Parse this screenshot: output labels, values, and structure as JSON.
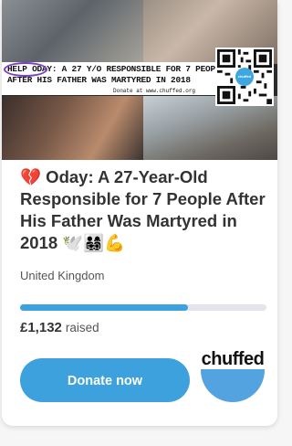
{
  "image": {
    "banner_line1": "HELP ODAY: A 27 Y/O RESPONSIBLE FOR 7 PEOPLE",
    "banner_line2": "AFTER HIS FATHER WAS MARTYRED IN 2018",
    "donate_at": "Donate at www.chuffed.org",
    "qr_logo_text": "chuffed"
  },
  "campaign": {
    "title": "💔 Oday: A 27-Year-Old Responsible for 7 People After His Father Was Martyred in 2018 🕊️👨‍👩‍👧‍👦💪",
    "location": "United Kingdom",
    "progress_fraction": 0.68,
    "amount": "£1,132",
    "raised_label": "raised",
    "donate_label": "Donate now"
  },
  "brand": {
    "name": "chuffed"
  },
  "colors": {
    "accent": "#3da1dd",
    "track": "#e4e4ec",
    "ring": "#7b3fc4"
  }
}
